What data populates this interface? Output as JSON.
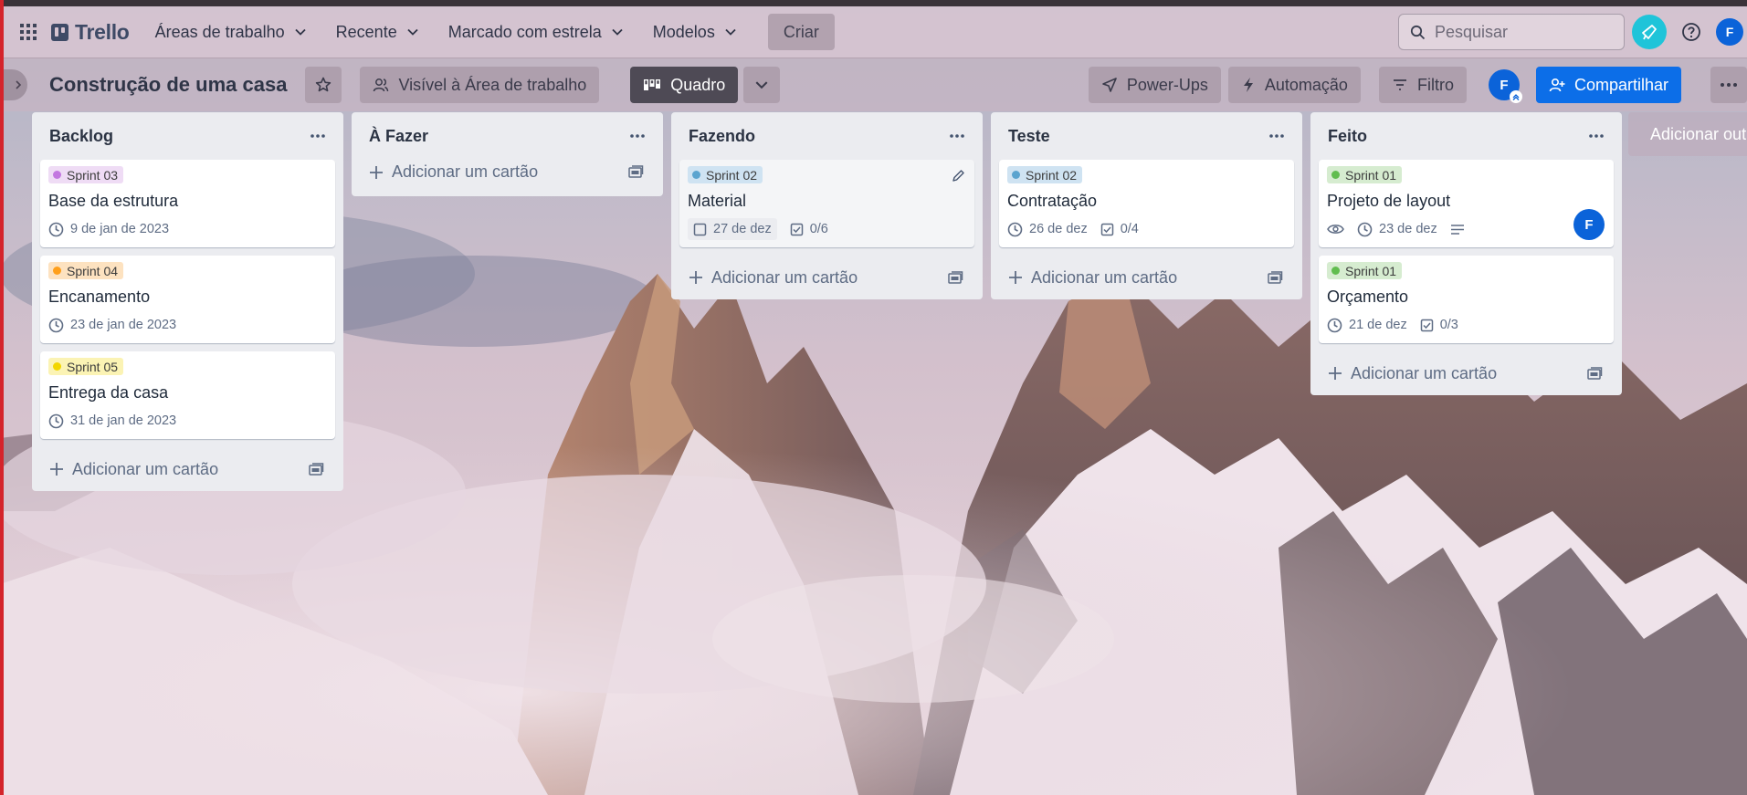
{
  "topnav": {
    "brand": "Trello",
    "menu": [
      {
        "label": "Áreas de trabalho"
      },
      {
        "label": "Recente"
      },
      {
        "label": "Marcado com estrela"
      },
      {
        "label": "Modelos"
      }
    ],
    "create_label": "Criar",
    "search_placeholder": "Pesquisar",
    "avatar_initial": "F"
  },
  "board": {
    "title": "Construção de uma casa",
    "visibility_label": "Visível à Área de trabalho",
    "view_label": "Quadro",
    "powerups_label": "Power-Ups",
    "automation_label": "Automação",
    "filter_label": "Filtro",
    "member_initial": "F",
    "share_label": "Compartilhar"
  },
  "colors": {
    "accent_blue": "#0c6ee8",
    "avatar_blue": "#0b63d9",
    "notification_cyan": "#1fc4d9",
    "sprint_01": "#61bd4f",
    "sprint_02": "#5ba4cf",
    "sprint_03": "#c377e0",
    "sprint_04": "#ff9f1a",
    "sprint_05": "#f2d600"
  },
  "lists": [
    {
      "title": "Backlog",
      "add_label": "Adicionar um cartão",
      "cards": [
        {
          "label": "Sprint 03",
          "title": "Base da estrutura",
          "date": "9 de jan de 2023"
        },
        {
          "label": "Sprint 04",
          "title": "Encanamento",
          "date": "23 de jan de 2023"
        },
        {
          "label": "Sprint 05",
          "title": "Entrega da casa",
          "date": "31 de jan de 2023"
        }
      ]
    },
    {
      "title": "À Fazer",
      "add_label": "Adicionar um cartão",
      "cards": []
    },
    {
      "title": "Fazendo",
      "add_label": "Adicionar um cartão",
      "cards": [
        {
          "label": "Sprint 02",
          "title": "Material",
          "date": "27 de dez",
          "checklist": "0/6"
        }
      ]
    },
    {
      "title": "Teste",
      "add_label": "Adicionar um cartão",
      "cards": [
        {
          "label": "Sprint 02",
          "title": "Contratação",
          "date": "26 de dez",
          "checklist": "0/4"
        }
      ]
    },
    {
      "title": "Feito",
      "add_label": "Adicionar um cartão",
      "cards": [
        {
          "label": "Sprint 01",
          "title": "Projeto de layout",
          "date": "23 de dez",
          "member_initial": "F"
        },
        {
          "label": "Sprint 01",
          "title": "Orçamento",
          "date": "21 de dez",
          "checklist": "0/3"
        }
      ]
    }
  ],
  "add_list_label": "Adicionar outra lista"
}
